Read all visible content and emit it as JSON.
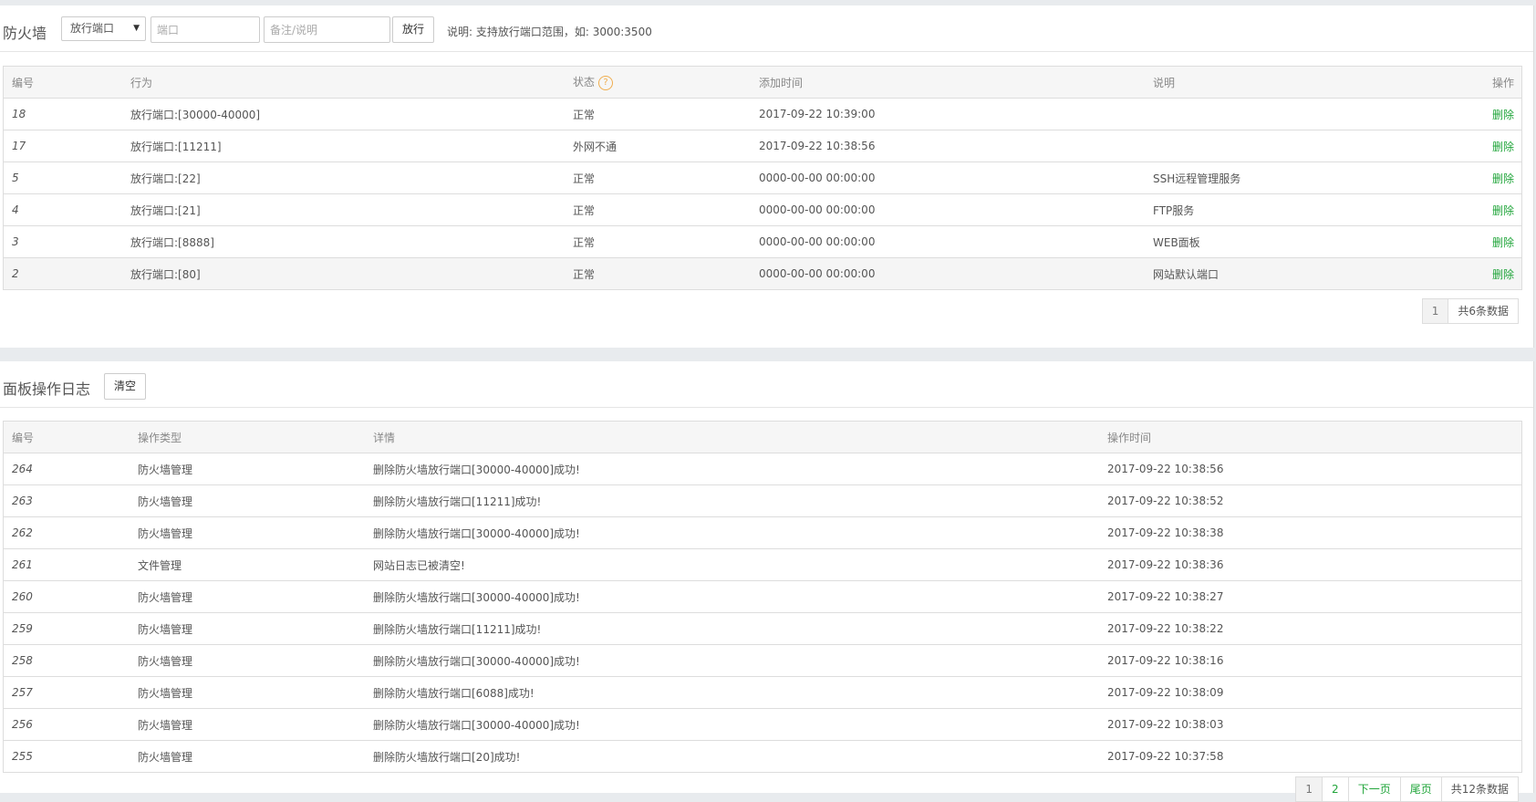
{
  "firewall": {
    "title": "防火墙",
    "select_value": "放行端口",
    "port_placeholder": "端口",
    "note_placeholder": "备注/说明",
    "release_button": "放行",
    "hint": "说明: 支持放行端口范围，如: 3000:3500",
    "headers": {
      "id": "编号",
      "action": "行为",
      "status": "状态",
      "time": "添加时间",
      "note": "说明",
      "op": "操作"
    },
    "help_icon": "?",
    "rows": [
      {
        "id": "18",
        "action": "放行端口:[30000-40000]",
        "status": "正常",
        "time": "2017-09-22 10:39:00",
        "note": "",
        "op": "删除"
      },
      {
        "id": "17",
        "action": "放行端口:[11211]",
        "status": "外网不通",
        "time": "2017-09-22 10:38:56",
        "note": "",
        "op": "删除"
      },
      {
        "id": "5",
        "action": "放行端口:[22]",
        "status": "正常",
        "time": "0000-00-00 00:00:00",
        "note": "SSH远程管理服务",
        "op": "删除"
      },
      {
        "id": "4",
        "action": "放行端口:[21]",
        "status": "正常",
        "time": "0000-00-00 00:00:00",
        "note": "FTP服务",
        "op": "删除"
      },
      {
        "id": "3",
        "action": "放行端口:[8888]",
        "status": "正常",
        "time": "0000-00-00 00:00:00",
        "note": "WEB面板",
        "op": "删除"
      },
      {
        "id": "2",
        "action": "放行端口:[80]",
        "status": "正常",
        "time": "0000-00-00 00:00:00",
        "note": "网站默认端口",
        "op": "删除"
      }
    ],
    "pager": {
      "current": "1",
      "total": "共6条数据"
    }
  },
  "logs": {
    "title": "面板操作日志",
    "clear_button": "清空",
    "headers": {
      "id": "编号",
      "type": "操作类型",
      "detail": "详情",
      "time": "操作时间"
    },
    "rows": [
      {
        "id": "264",
        "type": "防火墙管理",
        "detail": "删除防火墙放行端口[30000-40000]成功!",
        "time": "2017-09-22 10:38:56"
      },
      {
        "id": "263",
        "type": "防火墙管理",
        "detail": "删除防火墙放行端口[11211]成功!",
        "time": "2017-09-22 10:38:52"
      },
      {
        "id": "262",
        "type": "防火墙管理",
        "detail": "删除防火墙放行端口[30000-40000]成功!",
        "time": "2017-09-22 10:38:38"
      },
      {
        "id": "261",
        "type": "文件管理",
        "detail": "网站日志已被清空!",
        "time": "2017-09-22 10:38:36"
      },
      {
        "id": "260",
        "type": "防火墙管理",
        "detail": "删除防火墙放行端口[30000-40000]成功!",
        "time": "2017-09-22 10:38:27"
      },
      {
        "id": "259",
        "type": "防火墙管理",
        "detail": "删除防火墙放行端口[11211]成功!",
        "time": "2017-09-22 10:38:22"
      },
      {
        "id": "258",
        "type": "防火墙管理",
        "detail": "删除防火墙放行端口[30000-40000]成功!",
        "time": "2017-09-22 10:38:16"
      },
      {
        "id": "257",
        "type": "防火墙管理",
        "detail": "删除防火墙放行端口[6088]成功!",
        "time": "2017-09-22 10:38:09"
      },
      {
        "id": "256",
        "type": "防火墙管理",
        "detail": "删除防火墙放行端口[30000-40000]成功!",
        "time": "2017-09-22 10:38:03"
      },
      {
        "id": "255",
        "type": "防火墙管理",
        "detail": "删除防火墙放行端口[20]成功!",
        "time": "2017-09-22 10:37:58"
      }
    ],
    "pager": {
      "current": "1",
      "page2": "2",
      "next": "下一页",
      "last": "尾页",
      "total": "共12条数据"
    }
  },
  "colors": {
    "accent": "#20a53a",
    "warning": "#f0ad4e",
    "bg": "#e8ebee"
  }
}
